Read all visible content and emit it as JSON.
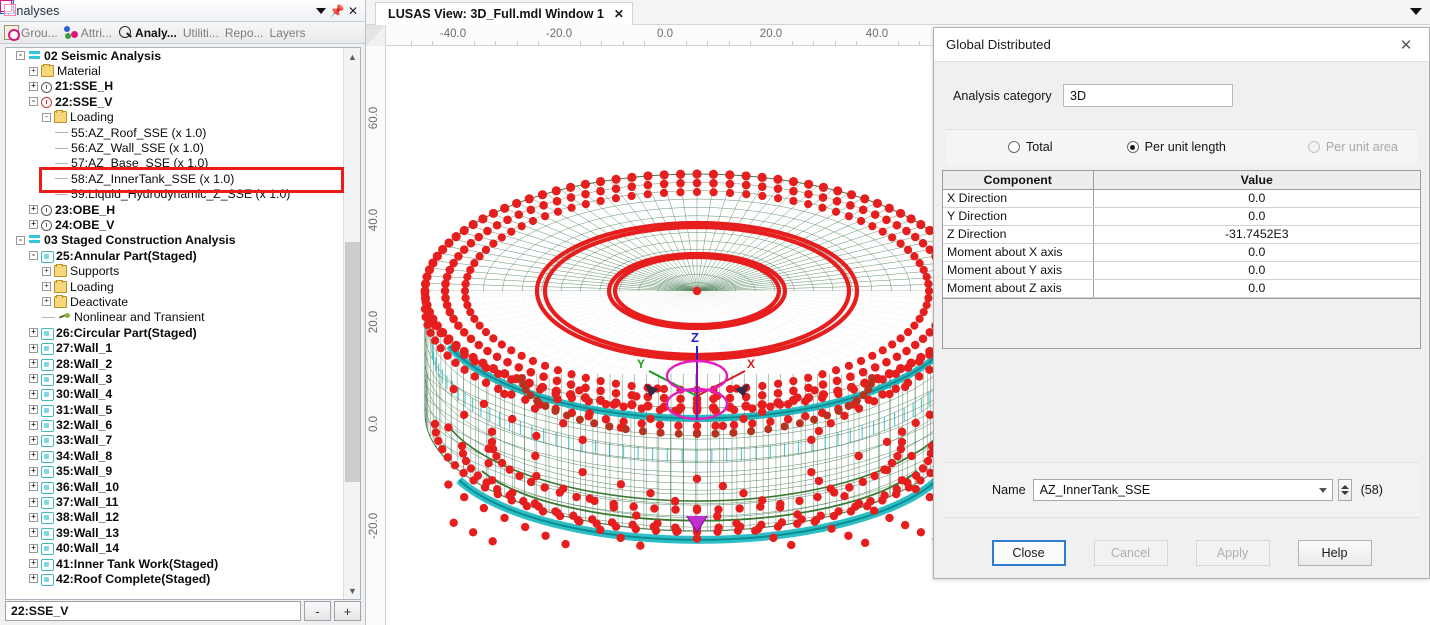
{
  "panel": {
    "title": "Analyses",
    "controls": {
      "menu": "▼",
      "pin": "Π",
      "close": "✕"
    },
    "toolbar": [
      {
        "label": "Grou...",
        "icon": "groups-icon",
        "active": false
      },
      {
        "label": "Attri...",
        "icon": "attributes-icon",
        "active": false
      },
      {
        "label": "Analy...",
        "icon": "analyses-icon",
        "active": true
      },
      {
        "label": "Utiliti...",
        "icon": "utilities-icon",
        "active": false
      },
      {
        "label": "Repo...",
        "icon": "reports-icon",
        "active": false
      },
      {
        "label": "Layers",
        "icon": "layers-icon",
        "active": false
      }
    ],
    "status_value": "22:SSE_V",
    "minus_label": "-",
    "plus_label": "+"
  },
  "tree": [
    {
      "label": "02 Seismic Analysis",
      "indent": 0,
      "icon": "analysis-icon",
      "exp": "-",
      "bold": true
    },
    {
      "label": "Material",
      "indent": 1,
      "icon": "folder-icon",
      "exp": "+",
      "bold": false
    },
    {
      "label": "21:SSE_H",
      "indent": 1,
      "icon": "clock-icon",
      "exp": "+",
      "bold": true
    },
    {
      "label": "22:SSE_V",
      "indent": 1,
      "icon": "clock-red-icon",
      "exp": "-",
      "bold": true
    },
    {
      "label": "Loading",
      "indent": 2,
      "icon": "folder-icon",
      "exp": "-",
      "bold": false
    },
    {
      "label": "55:AZ_Roof_SSE (x 1.0)",
      "indent": 3,
      "icon": "none",
      "exp": "dash",
      "bold": false
    },
    {
      "label": "56:AZ_Wall_SSE (x 1.0)",
      "indent": 3,
      "icon": "none",
      "exp": "dash",
      "bold": false
    },
    {
      "label": "57:AZ_Base_SSE (x 1.0)",
      "indent": 3,
      "icon": "none",
      "exp": "dash",
      "bold": false
    },
    {
      "label": "58:AZ_InnerTank_SSE (x 1.0)",
      "indent": 3,
      "icon": "none",
      "exp": "dash",
      "bold": false
    },
    {
      "label": "59:Liquid_Hydrodynamic_Z_SSE (x 1.0)",
      "indent": 3,
      "icon": "none",
      "exp": "dash",
      "bold": false
    },
    {
      "label": "23:OBE_H",
      "indent": 1,
      "icon": "clock-icon",
      "exp": "+",
      "bold": true
    },
    {
      "label": "24:OBE_V",
      "indent": 1,
      "icon": "clock-icon",
      "exp": "+",
      "bold": true
    },
    {
      "label": "03 Staged Construction Analysis",
      "indent": 0,
      "icon": "analysis-icon",
      "exp": "-",
      "bold": true
    },
    {
      "label": "25:Annular Part(Staged)",
      "indent": 1,
      "icon": "stage-icon",
      "exp": "-",
      "bold": true
    },
    {
      "label": "Supports",
      "indent": 2,
      "icon": "folder-icon",
      "exp": "+",
      "bold": false
    },
    {
      "label": "Loading",
      "indent": 2,
      "icon": "folder-icon",
      "exp": "+",
      "bold": false
    },
    {
      "label": "Deactivate",
      "indent": 2,
      "icon": "folder-icon",
      "exp": "+",
      "bold": false
    },
    {
      "label": "Nonlinear and Transient",
      "indent": 2,
      "icon": "nonlinear-icon",
      "exp": "dash",
      "bold": false
    },
    {
      "label": "26:Circular Part(Staged)",
      "indent": 1,
      "icon": "stage-icon",
      "exp": "+",
      "bold": true
    },
    {
      "label": "27:Wall_1",
      "indent": 1,
      "icon": "stage-icon",
      "exp": "+",
      "bold": true
    },
    {
      "label": "28:Wall_2",
      "indent": 1,
      "icon": "stage-icon",
      "exp": "+",
      "bold": true
    },
    {
      "label": "29:Wall_3",
      "indent": 1,
      "icon": "stage-icon",
      "exp": "+",
      "bold": true
    },
    {
      "label": "30:Wall_4",
      "indent": 1,
      "icon": "stage-icon",
      "exp": "+",
      "bold": true
    },
    {
      "label": "31:Wall_5",
      "indent": 1,
      "icon": "stage-icon",
      "exp": "+",
      "bold": true
    },
    {
      "label": "32:Wall_6",
      "indent": 1,
      "icon": "stage-icon",
      "exp": "+",
      "bold": true
    },
    {
      "label": "33:Wall_7",
      "indent": 1,
      "icon": "stage-icon",
      "exp": "+",
      "bold": true
    },
    {
      "label": "34:Wall_8",
      "indent": 1,
      "icon": "stage-icon",
      "exp": "+",
      "bold": true
    },
    {
      "label": "35:Wall_9",
      "indent": 1,
      "icon": "stage-icon",
      "exp": "+",
      "bold": true
    },
    {
      "label": "36:Wall_10",
      "indent": 1,
      "icon": "stage-icon",
      "exp": "+",
      "bold": true
    },
    {
      "label": "37:Wall_11",
      "indent": 1,
      "icon": "stage-icon",
      "exp": "+",
      "bold": true
    },
    {
      "label": "38:Wall_12",
      "indent": 1,
      "icon": "stage-icon",
      "exp": "+",
      "bold": true
    },
    {
      "label": "39:Wall_13",
      "indent": 1,
      "icon": "stage-icon",
      "exp": "+",
      "bold": true
    },
    {
      "label": "40:Wall_14",
      "indent": 1,
      "icon": "stage-icon",
      "exp": "+",
      "bold": true
    },
    {
      "label": "41:Inner Tank Work(Staged)",
      "indent": 1,
      "icon": "stage-icon",
      "exp": "+",
      "bold": true
    },
    {
      "label": "42:Roof Complete(Staged)",
      "indent": 1,
      "icon": "stage-icon",
      "exp": "+",
      "bold": true
    }
  ],
  "highlight": {
    "row_index": 8,
    "color": "#ee1b1b"
  },
  "document_tab": {
    "title": "LUSAS View: 3D_Full.mdl Window 1",
    "close": "✕"
  },
  "rulers": {
    "horizontal": [
      "-40.0",
      "-20.0",
      "0.0",
      "20.0",
      "40.0"
    ],
    "vertical": [
      "60.0",
      "40.0",
      "20.0",
      "0.0",
      "-20.0"
    ]
  },
  "viewport": {
    "axes": {
      "x": "X",
      "y": "Y",
      "z": "Z"
    },
    "colors": {
      "mesh": "#3e7a4e",
      "load_marker": "#e61e1e",
      "inner_tank": "#16b7c0",
      "axis_z": "#2222cc",
      "axis_y": "#1a9a1a",
      "axis_x": "#cc2222",
      "rotation": "#e21fc0"
    }
  },
  "dialog": {
    "title": "Global Distributed",
    "close": "✕",
    "analysis_category_label": "Analysis category",
    "analysis_category_value": "3D",
    "options": [
      {
        "label": "Total",
        "selected": false,
        "disabled": false
      },
      {
        "label": "Per unit length",
        "selected": true,
        "disabled": false
      },
      {
        "label": "Per unit area",
        "selected": false,
        "disabled": true
      }
    ],
    "table": {
      "headers": [
        "Component",
        "Value"
      ],
      "rows": [
        {
          "component": "X Direction",
          "value": "0.0"
        },
        {
          "component": "Y Direction",
          "value": "0.0"
        },
        {
          "component": "Z Direction",
          "value": "-31.7452E3"
        },
        {
          "component": "Moment about X axis",
          "value": "0.0"
        },
        {
          "component": "Moment about Y axis",
          "value": "0.0"
        },
        {
          "component": "Moment about Z axis",
          "value": "0.0"
        }
      ]
    },
    "name_label": "Name",
    "name_value": "AZ_InnerTank_SSE",
    "name_index": "(58)",
    "buttons": [
      {
        "label": "Close",
        "primary": true,
        "disabled": false
      },
      {
        "label": "Cancel",
        "primary": false,
        "disabled": true
      },
      {
        "label": "Apply",
        "primary": false,
        "disabled": true
      },
      {
        "label": "Help",
        "primary": false,
        "disabled": false
      }
    ]
  }
}
